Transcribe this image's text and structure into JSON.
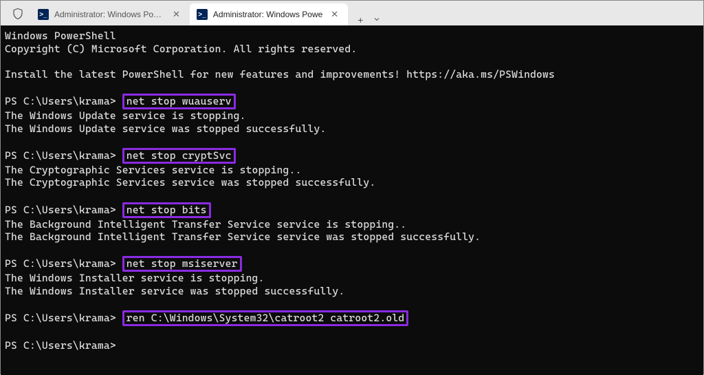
{
  "tabs": {
    "inactive": {
      "title": "Administrator: Windows Power"
    },
    "active": {
      "title": "Administrator: Windows Powe"
    }
  },
  "ps_icon_text": ">_",
  "header": {
    "line1": "Windows PowerShell",
    "line2": "Copyright (C) Microsoft Corporation. All rights reserved.",
    "install": "Install the latest PowerShell for new features and improvements! https://aka.ms/PSWindows"
  },
  "prompt": "PS C:\\Users\\krama> ",
  "blocks": [
    {
      "cmd": "net stop wuauserv",
      "out": [
        "The Windows Update service is stopping.",
        "The Windows Update service was stopped successfully."
      ]
    },
    {
      "cmd": "net stop cryptSvc",
      "out": [
        "The Cryptographic Services service is stopping..",
        "The Cryptographic Services service was stopped successfully."
      ]
    },
    {
      "cmd": "net stop bits",
      "out": [
        "The Background Intelligent Transfer Service service is stopping..",
        "The Background Intelligent Transfer Service service was stopped successfully."
      ]
    },
    {
      "cmd": "net stop msiserver",
      "out": [
        "The Windows Installer service is stopping.",
        "The Windows Installer service was stopped successfully."
      ]
    },
    {
      "cmd": "ren C:\\Windows\\System32\\catroot2 catroot2.old",
      "out": []
    }
  ],
  "trailing_prompt": "PS C:\\Users\\krama>"
}
